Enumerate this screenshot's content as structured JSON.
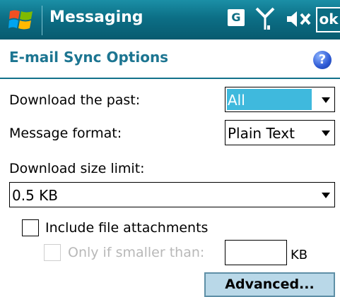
{
  "titlebar": {
    "title": "Messaging",
    "g_label": "G",
    "ok_label": "ok"
  },
  "header": {
    "title": "E-mail Sync Options",
    "help_label": "?"
  },
  "form": {
    "download_past": {
      "label": "Download the past:",
      "value": "All"
    },
    "message_format": {
      "label": "Message format:",
      "value": "Plain Text"
    },
    "download_size": {
      "label": "Download size limit:",
      "value": "0.5 KB"
    },
    "include_attachments": {
      "label": "Include file attachments",
      "checked": false
    },
    "only_if_smaller": {
      "label": "Only if smaller than:",
      "checked": false,
      "enabled": false,
      "value": "",
      "unit": "KB"
    },
    "advanced_button": "Advanced..."
  },
  "colors": {
    "titlebar": "#0c6f86",
    "accent": "#1c7591",
    "selection": "#3fb9dd",
    "button": "#b9d8e8"
  }
}
